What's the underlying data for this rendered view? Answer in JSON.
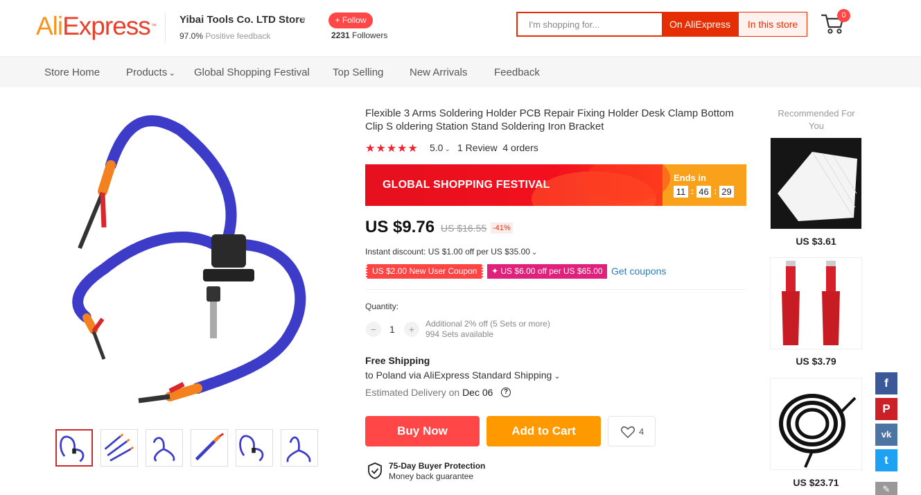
{
  "header": {
    "logo": {
      "part1": "Ali",
      "part2": "Express",
      "tm": "™"
    },
    "store_name": "Yibai Tools Co. LTD Store",
    "feedback_pct": "97.0%",
    "feedback_label": "Positive feedback",
    "follow_label": "+ Follow",
    "followers_count": "2231",
    "followers_label": "Followers",
    "search_placeholder": "I'm shopping for...",
    "search_on_label": "On AliExpress",
    "search_in_label": "In this store",
    "cart_count": "0"
  },
  "nav": {
    "items": [
      "Store Home",
      "Products",
      "Global Shopping Festival",
      "Top Selling",
      "New Arrivals",
      "Feedback"
    ]
  },
  "gallery": {
    "thumbnail_count": 6,
    "active_index": 0
  },
  "product": {
    "title": "Flexible 3 Arms Soldering Holder PCB Repair Fixing Holder Desk Clamp Bottom Clip S oldering Station Stand Soldering Iron Bracket",
    "stars": "★★★★★",
    "rating": "5.0",
    "reviews": "1 Review",
    "orders": "4 orders",
    "banner": {
      "text": "GLOBAL SHOPPING FESTIVAL",
      "ends_label": "Ends in",
      "hours": "11",
      "minutes": "46",
      "seconds": "29",
      "sep": ":"
    },
    "price": "US $9.76",
    "old_price": "US $16.55",
    "discount": "-41%",
    "instant_discount": "Instant discount: US $1.00 off per US $35.00",
    "coupon1": "US $2.00 New User Coupon",
    "coupon2": "US $6.00 off per US $65.00",
    "get_coupons": "Get coupons",
    "quantity_label": "Quantity:",
    "quantity_value": "1",
    "minus": "−",
    "plus": "+",
    "qty_note1": "Additional 2% off (5 Sets or more)",
    "qty_note2": "994 Sets available",
    "shipping_title": "Free Shipping",
    "shipping_to": "to Poland via AliExpress Standard Shipping",
    "est_label": "Estimated Delivery on",
    "est_date": "Dec 06",
    "buy_label": "Buy Now",
    "cart_label": "Add to Cart",
    "wish_count": "4",
    "protection_title": "75-Day Buyer Protection",
    "protection_sub": "Money back guarantee"
  },
  "recommended": {
    "title": "Recommended For You",
    "items": [
      {
        "price": "US $3.61"
      },
      {
        "price": "US $3.79"
      },
      {
        "price": "US $23.71"
      }
    ]
  },
  "social": [
    "f",
    "P",
    "vk",
    "t"
  ],
  "colors": {
    "brand": "#e62e04",
    "accent": "#ff4747",
    "orange": "#ff9900",
    "link": "#2e7bbf"
  }
}
